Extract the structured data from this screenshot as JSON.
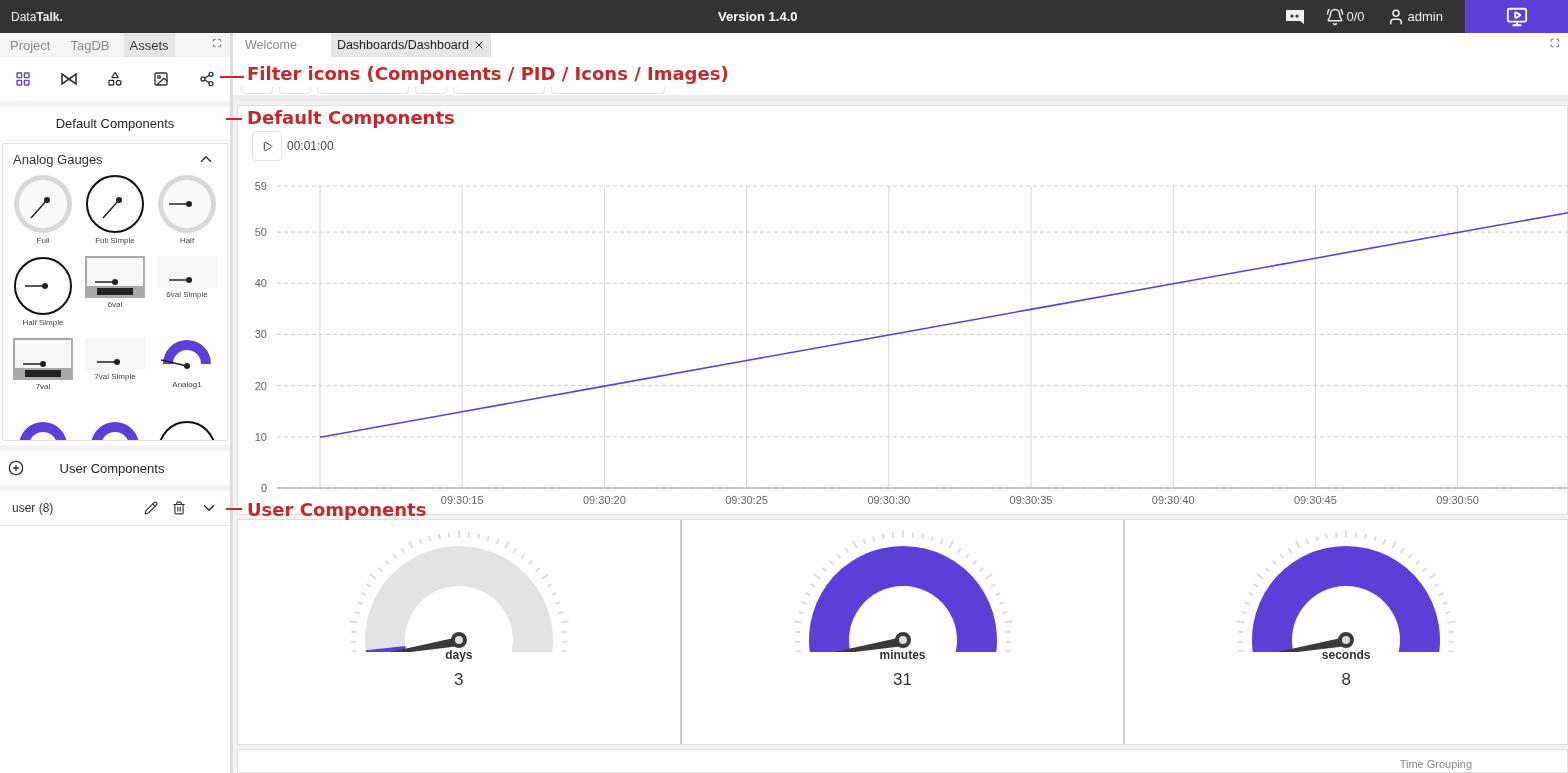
{
  "topbar": {
    "logo_light": "Data",
    "logo_bold": "Talk.",
    "version": "Version 1.4.0",
    "alarms": "0/0",
    "user": "admin"
  },
  "left_tabs": [
    {
      "label": "Project",
      "selected": false
    },
    {
      "label": "TagDB",
      "selected": false
    },
    {
      "label": "Assets",
      "selected": true
    }
  ],
  "filters": [
    {
      "kind": "components",
      "selected": true
    },
    {
      "kind": "pid",
      "selected": false
    },
    {
      "kind": "shapes",
      "selected": false
    },
    {
      "kind": "images",
      "selected": false
    },
    {
      "kind": "tree",
      "selected": false
    }
  ],
  "default_components": {
    "title": "Default Components",
    "group": {
      "title": "Analog Gauges",
      "expanded": true,
      "items": [
        {
          "kind": "full",
          "label": "Full"
        },
        {
          "kind": "fullsimple",
          "label": "Full Simple"
        },
        {
          "kind": "half",
          "label": "Half"
        },
        {
          "kind": "halfsimple",
          "label": "Half Simple"
        },
        {
          "kind": "sixval",
          "label": "6val"
        },
        {
          "kind": "sixvalsimple",
          "label": "6val Simple"
        },
        {
          "kind": "sevenval",
          "label": "7val"
        },
        {
          "kind": "sevenvalsimple",
          "label": "7val Simple"
        },
        {
          "kind": "analog",
          "label": "Analog1"
        },
        {
          "kind": "analog"
        },
        {
          "kind": "analog"
        },
        {
          "kind": "fullsimple"
        }
      ]
    }
  },
  "user_components": {
    "title": "User Components",
    "groups": [
      {
        "label": "user (8)",
        "expanded": false
      }
    ]
  },
  "editor_tabs": [
    {
      "label": "Welcome",
      "selected": false,
      "closable": false
    },
    {
      "label": "Dashboards/Dashboard",
      "selected": true,
      "closable": true
    }
  ],
  "chart_panel": {
    "duration": "00:01:00",
    "chart_data": {
      "type": "line",
      "categories": [
        null,
        "09:30:15",
        "09:30:20",
        "09:30:25",
        "09:30:30",
        "09:30:35",
        "09:30:40",
        "09:30:45",
        "09:30:50",
        null
      ],
      "series": [
        {
          "color": "#5b3fd6",
          "values": [
            9.9,
            14.9,
            19.9,
            24.9,
            29.9,
            34.9,
            39.9,
            44.9,
            49.9,
            54.9
          ]
        }
      ],
      "grid": true,
      "ylim": [
        0,
        59
      ],
      "yticks": [
        0,
        10,
        20,
        30,
        40,
        50,
        59
      ]
    }
  },
  "gauges": [
    {
      "label": "days",
      "value": "3"
    },
    {
      "label": "minutes",
      "value": "31"
    },
    {
      "label": "seconds",
      "value": "8"
    }
  ],
  "bottom_panel": {
    "label": "Time Grouping"
  },
  "annotations": [
    {
      "text": "Filter icons (Components / PID / Icons / Images)"
    },
    {
      "text": "Default Components"
    },
    {
      "text": "User Components"
    }
  ]
}
